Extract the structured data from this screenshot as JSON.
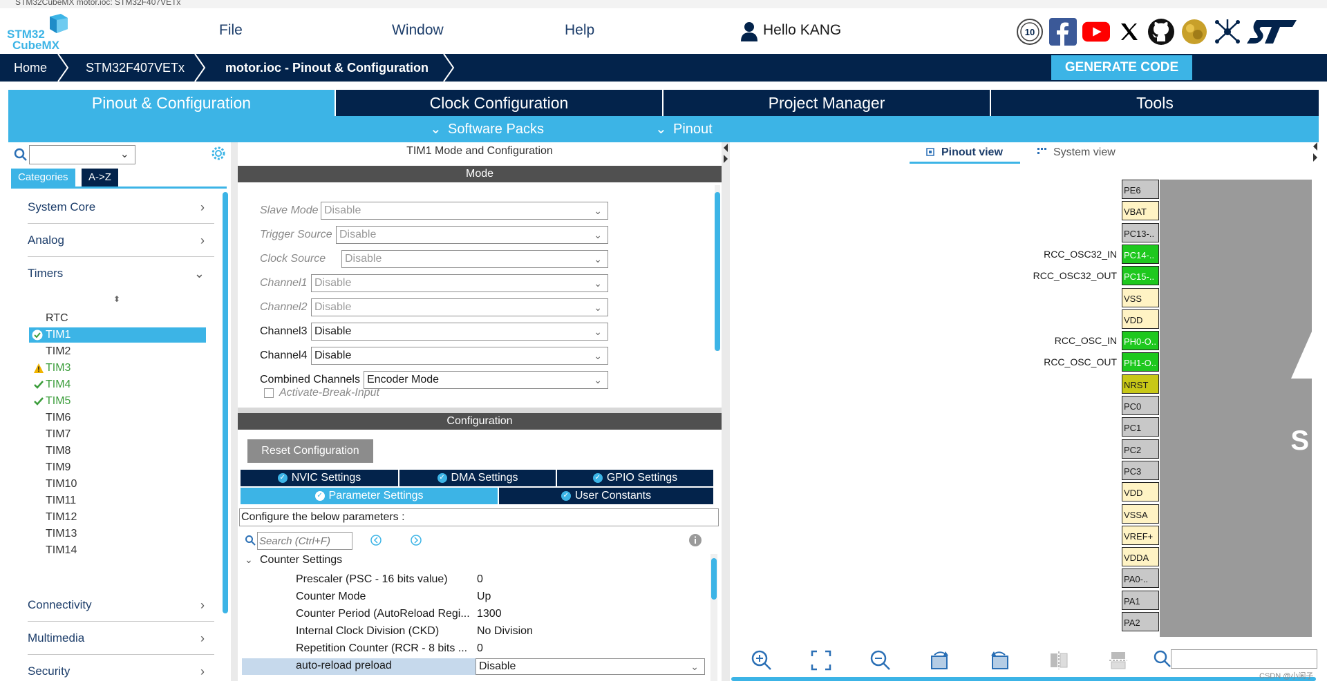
{
  "window": {
    "title": "STM32CubeMX motor.ioc: STM32F407VETx"
  },
  "logo": {
    "line1": "STM32",
    "line2": "CubeMX"
  },
  "menu": {
    "file": "File",
    "window": "Window",
    "help": "Help",
    "user": "Hello KANG"
  },
  "breadcrumb": {
    "home": "Home",
    "device": "STM32F407VETx",
    "project": "motor.ioc - Pinout & Configuration"
  },
  "generate_label": "GENERATE CODE",
  "tabs": [
    "Pinout & Configuration",
    "Clock Configuration",
    "Project Manager",
    "Tools"
  ],
  "subtabs": {
    "software_packs": "Software Packs",
    "pinout": "Pinout"
  },
  "left": {
    "tabs": {
      "categories": "Categories",
      "az": "A->Z"
    },
    "categories": {
      "system_core": "System Core",
      "analog": "Analog",
      "timers": "Timers",
      "connectivity": "Connectivity",
      "multimedia": "Multimedia",
      "security": "Security"
    },
    "timers": [
      "RTC",
      "TIM1",
      "TIM2",
      "TIM3",
      "TIM4",
      "TIM5",
      "TIM6",
      "TIM7",
      "TIM8",
      "TIM9",
      "TIM10",
      "TIM11",
      "TIM12",
      "TIM13",
      "TIM14"
    ]
  },
  "mid": {
    "title": "TIM1 Mode and Configuration",
    "mode_header": "Mode",
    "rows": [
      {
        "label": "Slave Mode",
        "value": "Disable"
      },
      {
        "label": "Trigger Source",
        "value": "Disable"
      },
      {
        "label": "Clock Source",
        "value": "Disable"
      },
      {
        "label": "Channel1",
        "value": "Disable"
      },
      {
        "label": "Channel2",
        "value": "Disable"
      },
      {
        "label": "Channel3",
        "value": "Disable"
      },
      {
        "label": "Channel4",
        "value": "Disable"
      },
      {
        "label": "Combined Channels",
        "value": "Encoder Mode"
      }
    ],
    "break_input": "Activate-Break-Input",
    "config_header": "Configuration",
    "reset_label": "Reset Configuration",
    "settings_tabs": {
      "nvic": "NVIC Settings",
      "dma": "DMA Settings",
      "gpio": "GPIO Settings",
      "params": "Parameter Settings",
      "user": "User Constants"
    },
    "configure_text": "Configure the below parameters :",
    "search_placeholder": "Search (Ctrl+F)",
    "group": "Counter Settings",
    "params": [
      {
        "label": "Prescaler (PSC - 16 bits value)",
        "value": "0"
      },
      {
        "label": "Counter Mode",
        "value": "Up"
      },
      {
        "label": "Counter Period (AutoReload Regi...",
        "value": "1300"
      },
      {
        "label": "Internal Clock Division (CKD)",
        "value": "No Division"
      },
      {
        "label": "Repetition Counter (RCR - 8 bits ...",
        "value": "0"
      },
      {
        "label": "auto-reload preload",
        "value": "Disable"
      }
    ]
  },
  "right": {
    "pinout_view": "Pinout view",
    "system_view": "System view",
    "pins": [
      "PE6",
      "VBAT",
      "PC13-..",
      "PC14-..",
      "PC15-..",
      "VSS",
      "VDD",
      "PH0-O..",
      "PH1-O..",
      "NRST",
      "PC0",
      "PC1",
      "PC2",
      "PC3",
      "VDD",
      "VSSA",
      "VREF+",
      "VDDA",
      "PA0-..",
      "PA1",
      "PA2"
    ],
    "pin_labels": {
      "pc14": "RCC_OSC32_IN",
      "pc15": "RCC_OSC32_OUT",
      "ph0": "RCC_OSC_IN",
      "ph1": "RCC_OSC_OUT"
    },
    "chip_letter": "S"
  },
  "watermark": "CSDN @小闲子",
  "colors": {
    "navy": "#03234b",
    "accent": "#3cb4e6",
    "ok": "#3b9d3b",
    "warn": "#f0b400",
    "pin_green": "#1ec81e"
  }
}
